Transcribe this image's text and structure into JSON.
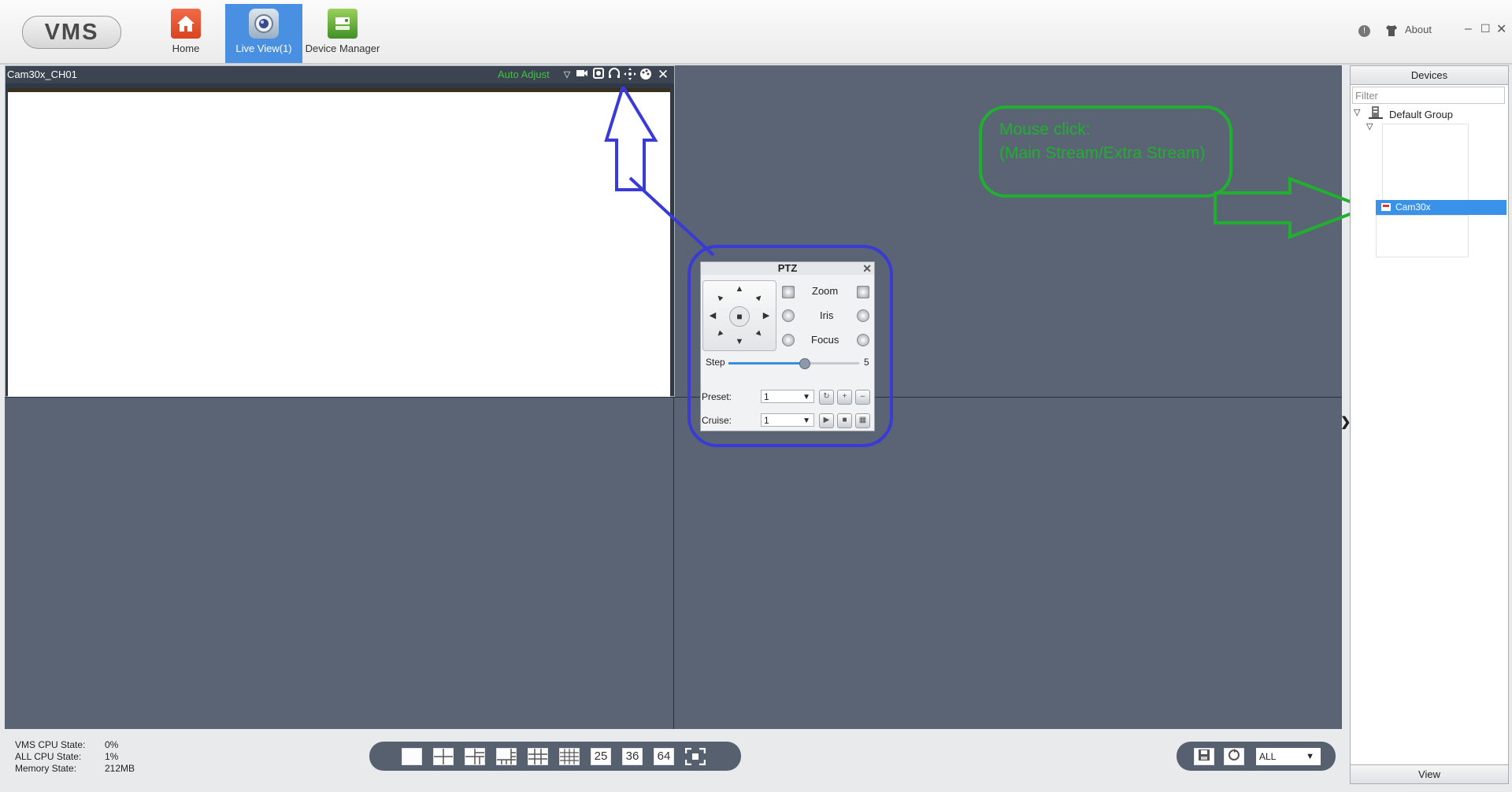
{
  "app": {
    "logo": "VMS",
    "nav": [
      {
        "label": "Home"
      },
      {
        "label": "Live View(1)"
      },
      {
        "label": "Device Manager"
      }
    ],
    "about_label": "About"
  },
  "live_view": {
    "channel_title": "Cam30x_CH01",
    "auto_adjust_label": "Auto Adjust"
  },
  "ptz": {
    "title": "PTZ",
    "zoom_label": "Zoom",
    "iris_label": "Iris",
    "focus_label": "Focus",
    "step_label": "Step",
    "step_value": "5",
    "step_fraction": 0.58,
    "preset_label": "Preset:",
    "preset_value": "1",
    "cruise_label": "Cruise:",
    "cruise_value": "1"
  },
  "annotation": {
    "text": "Mouse click:\n(Main Stream/Extra Stream)",
    "callout_color": "#20b030",
    "arrow_color": "#3a3ad6"
  },
  "devices": {
    "title": "Devices",
    "filter_placeholder": "Filter",
    "group": "Default Group",
    "camera": "Cam30x",
    "view_label": "View"
  },
  "status": {
    "vms_cpu_label": "VMS CPU State:",
    "vms_cpu_value": "0%",
    "all_cpu_label": "ALL CPU State:",
    "all_cpu_value": "1%",
    "memory_label": "Memory State:",
    "memory_value": "212MB"
  },
  "layouts": {
    "n25": "25",
    "n36": "36",
    "n64": "64"
  },
  "stream_filter": {
    "value": "ALL"
  }
}
